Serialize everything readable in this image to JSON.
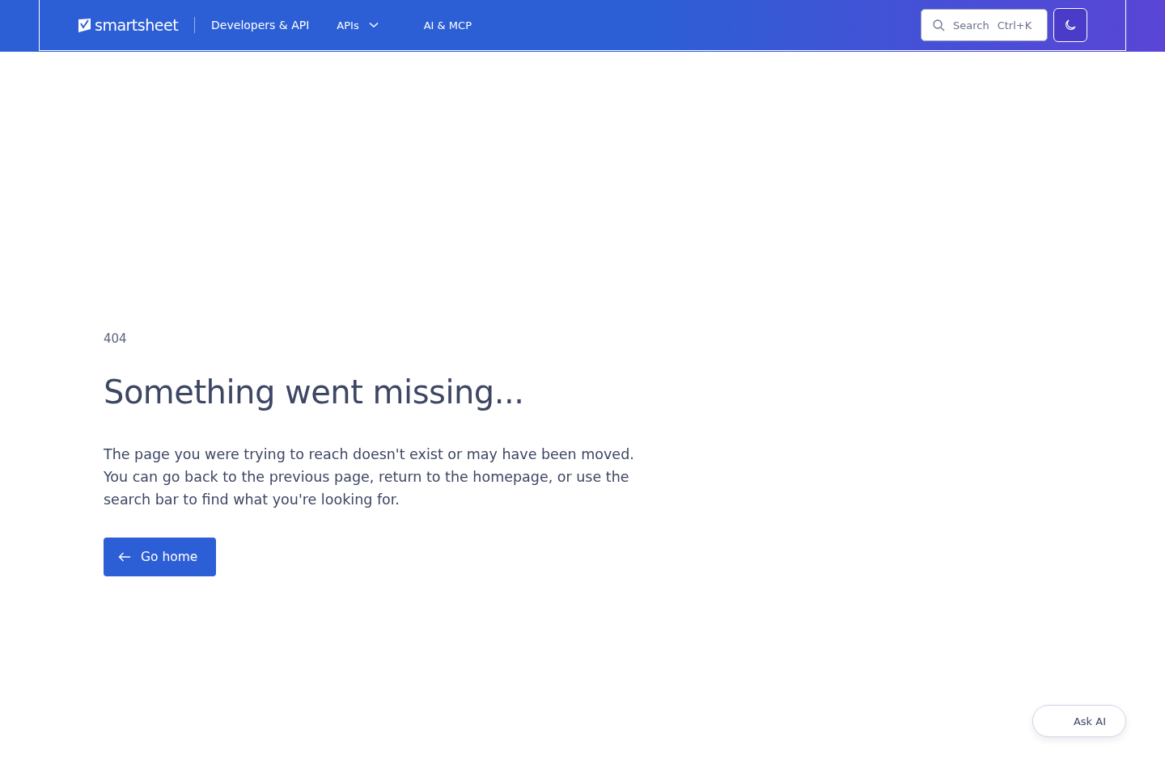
{
  "header": {
    "logo": "smartsheet",
    "section": "Developers & API",
    "nav": [
      {
        "label": "APIs",
        "kind": "dropdown"
      },
      {
        "label": "AI & MCP",
        "kind": "link"
      }
    ],
    "search": {
      "placeholder": "Search",
      "shortcut": "Ctrl+K"
    }
  },
  "error": {
    "code": "404",
    "title": "Something went missing...",
    "message": "The page you were trying to reach doesn't exist or may have been moved. You can go back to the previous page, return to the homepage, or use the search bar to find what you're looking for.",
    "button": "Go home"
  },
  "ask_ai": "Ask AI"
}
